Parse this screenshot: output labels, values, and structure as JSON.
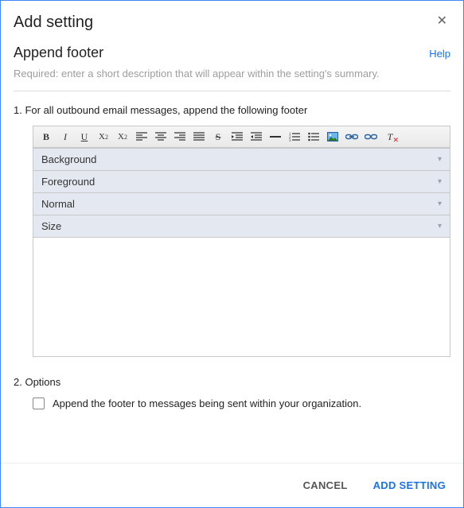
{
  "modal": {
    "title": "Add setting",
    "close_glyph": "✕"
  },
  "section": {
    "title": "Append footer",
    "help_label": "Help",
    "hint": "Required: enter a short description that will appear within the setting's summary."
  },
  "step1": {
    "label": "1. For all outbound email messages, append the following footer",
    "dropdowns": {
      "background": "Background",
      "foreground": "Foreground",
      "font_style": "Normal",
      "size": "Size"
    },
    "chevron": "▾"
  },
  "step2": {
    "label": "2. Options",
    "checkbox_label": "Append the footer to messages being sent within your organization."
  },
  "footer": {
    "cancel": "CANCEL",
    "confirm": "ADD SETTING"
  }
}
